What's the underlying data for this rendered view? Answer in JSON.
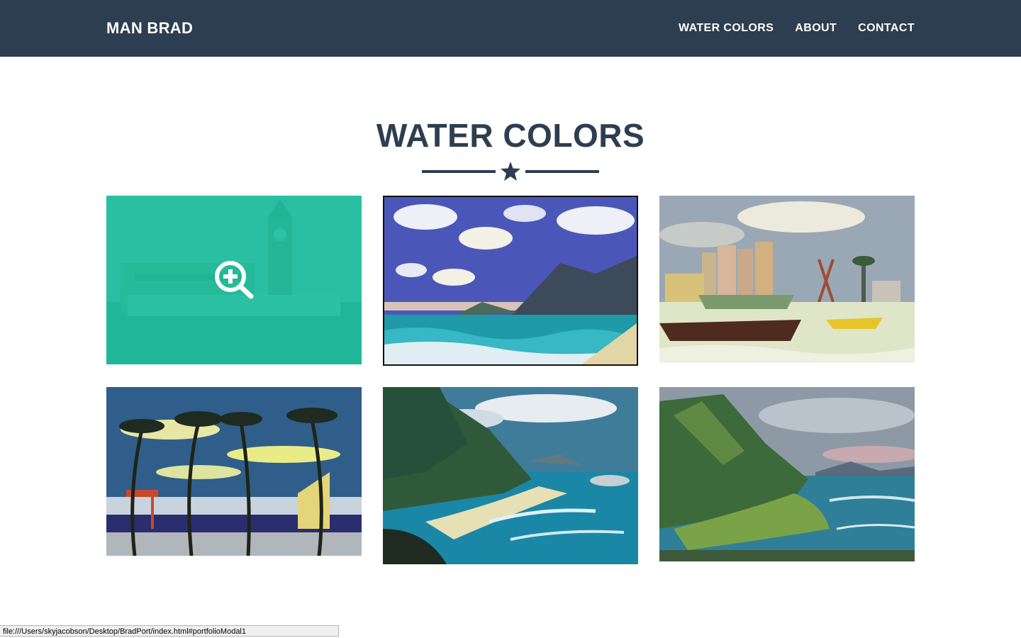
{
  "navbar": {
    "brand": "MAN BRAD",
    "links": [
      "WATER COLORS",
      "ABOUT",
      "CONTACT"
    ],
    "background": "#2c3e50"
  },
  "portfolio": {
    "title": "WATER COLORS",
    "accent": "#18bc9c",
    "heading_color": "#2c3e50",
    "items": [
      {
        "subject": "clock tower harbor painting (hovered, zoom overlay)",
        "icon": "zoom-in-icon"
      },
      {
        "subject": "beach with clouds and mountains"
      },
      {
        "subject": "harbor with silos, cranes and boats"
      },
      {
        "subject": "palm trees at beach with lifeguard tower"
      },
      {
        "subject": "green cliffs over blue bay"
      },
      {
        "subject": "green ridge over lagoon coastline"
      }
    ]
  },
  "statusbar": {
    "url": "file:///Users/skyjacobson/Desktop/BradPort/index.html#portfolioModal1"
  }
}
